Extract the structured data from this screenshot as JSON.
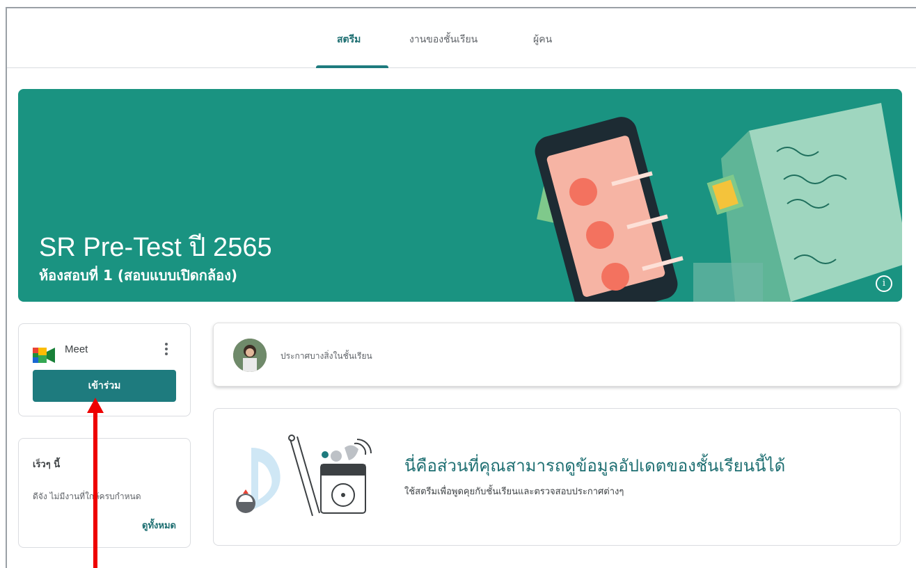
{
  "tabs": [
    {
      "label": "สตรีม",
      "active": true
    },
    {
      "label": "งานของชั้นเรียน",
      "active": false
    },
    {
      "label": "ผู้คน",
      "active": false
    }
  ],
  "banner": {
    "title": "SR Pre-Test ปี 2565",
    "subtitle": "ห้องสอบที่ 1 (สอบแบบเปิดกล้อง)",
    "color": "#1a9381",
    "info_icon": "info-icon"
  },
  "meet": {
    "label": "Meet",
    "join_label": "เข้าร่วม",
    "menu_icon": "more-vert-icon",
    "accent": "#1e7b7e"
  },
  "upcoming": {
    "title": "เร็วๆ นี้",
    "text": "ดีจัง ไม่มีงานที่ใกล้ครบกำหนด",
    "view_all": "ดูทั้งหมด"
  },
  "announce": {
    "placeholder": "ประกาศบางสิ่งในชั้นเรียน"
  },
  "info": {
    "title": "นี่คือส่วนที่คุณสามารถดูข้อมูลอัปเดตของชั้นเรียนนี้ได้",
    "subtitle": "ใช้สตรีมเพื่อพูดคุยกับชั้นเรียนและตรวจสอบประกาศต่างๆ"
  },
  "annotation": {
    "arrow_color": "#ee0000"
  }
}
